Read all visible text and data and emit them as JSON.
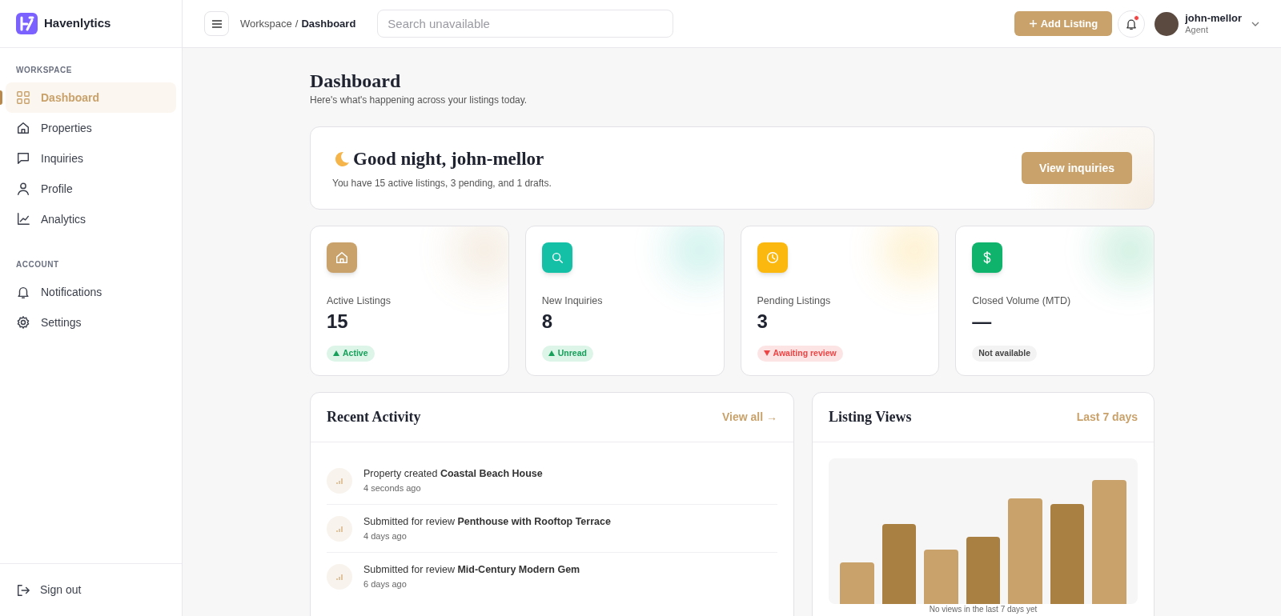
{
  "brand": {
    "name": "Havenlytics"
  },
  "sidebar": {
    "sections": [
      {
        "title": "WORKSPACE",
        "items": [
          {
            "label": "Dashboard",
            "selected": true
          },
          {
            "label": "Properties",
            "selected": false
          },
          {
            "label": "Inquiries",
            "selected": false
          },
          {
            "label": "Profile",
            "selected": false
          },
          {
            "label": "Analytics",
            "selected": false
          }
        ]
      },
      {
        "title": "ACCOUNT",
        "items": [
          {
            "label": "Notifications",
            "selected": false
          },
          {
            "label": "Settings",
            "selected": false
          }
        ]
      }
    ],
    "sign_out": "Sign out"
  },
  "header": {
    "breadcrumb": {
      "parent": "Workspace",
      "separator": "/",
      "current": "Dashboard"
    },
    "search": {
      "placeholder": "Search unavailable"
    },
    "add_button": "Add Listing",
    "notification_unread": true,
    "user": {
      "name": "john-mellor",
      "role": "Agent"
    }
  },
  "page": {
    "title": "Dashboard",
    "subtitle": "Here's what's happening across your listings today."
  },
  "greeting": {
    "title": "Good night, john-mellor",
    "text": "You have 15 active listings, 3 pending, and 1 drafts.",
    "button": "View inquiries"
  },
  "stats": [
    {
      "label": "Active Listings",
      "value": "15",
      "color": "#c9a26b",
      "badge": "Active",
      "kind": "up"
    },
    {
      "label": "New Inquiries",
      "value": "8",
      "color": "#14c0a6",
      "badge": "Unread",
      "kind": "up"
    },
    {
      "label": "Pending Listings",
      "value": "3",
      "color": "#fbb80f",
      "badge": "Awaiting review",
      "kind": "down"
    },
    {
      "label": "Closed Volume (MTD)",
      "value": "—",
      "color": "#0fb36b",
      "badge": "Not available",
      "kind": "neutral"
    }
  ],
  "activity": {
    "title": "Recent Activity",
    "link": "View all →",
    "items": [
      {
        "text": "Property created **Coastal Beach House**",
        "time": "4 seconds ago"
      },
      {
        "text": "Submitted for review **Penthouse with Rooftop Terrace**",
        "time": "4 days ago"
      },
      {
        "text": "Submitted for review **Mid-Century Modern Gem**",
        "time": "6 days ago"
      }
    ]
  },
  "views": {
    "title": "Listing Views",
    "range": "Last 7 days",
    "empty_text": "No views in the last 7 days yet"
  }
}
